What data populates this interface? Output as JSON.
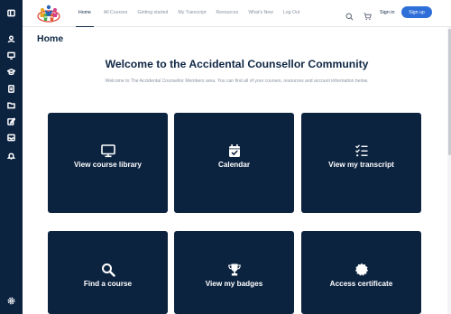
{
  "sidebar": {
    "icons": [
      "panel-toggle-icon",
      "user-icon",
      "monitor-icon",
      "graduation-cap-icon",
      "document-icon",
      "folder-icon",
      "edit-icon",
      "inbox-icon",
      "bell-icon",
      "settings-icon"
    ]
  },
  "header": {
    "nav": [
      "Home",
      "All Courses",
      "Getting started",
      "My Transcript",
      "Resources",
      "What's New",
      "Log Out"
    ],
    "active_nav": "Home",
    "sign_in": "Sign in",
    "sign_up": "Sign up"
  },
  "page": {
    "title": "Home",
    "welcome": "Welcome to the Accidental Counsellor Community",
    "subtitle": "Welcome to The Accidental Counsellor Members area. You can find all of your courses, resources and account information below."
  },
  "cards": [
    {
      "label": "View course library",
      "icon": "monitor-icon"
    },
    {
      "label": "Calendar",
      "icon": "calendar-check-icon"
    },
    {
      "label": "View my transcript",
      "icon": "checklist-icon"
    },
    {
      "label": "Find a course",
      "icon": "search-icon"
    },
    {
      "label": "View my badges",
      "icon": "trophy-icon"
    },
    {
      "label": "Access certificate",
      "icon": "certificate-badge-icon"
    }
  ],
  "colors": {
    "navy": "#0c2340",
    "accent_blue": "#2f6fd8",
    "muted_text": "#8a93a0"
  }
}
